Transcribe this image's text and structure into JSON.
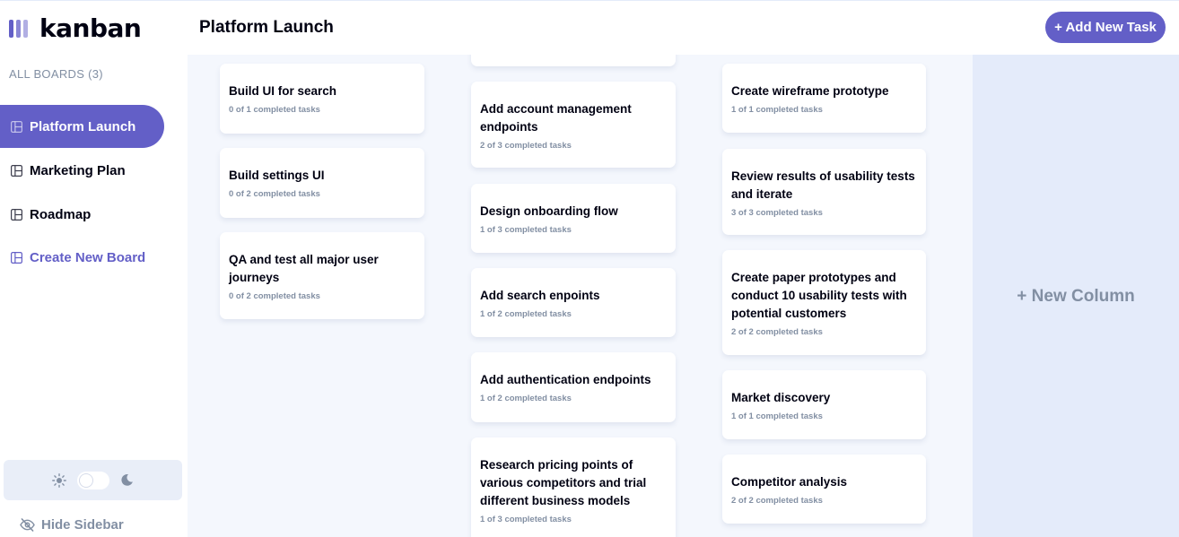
{
  "app": {
    "logo_text": "kanban",
    "accent": "#635fc7"
  },
  "sidebar": {
    "heading": "ALL BOARDS (3)",
    "boards": [
      {
        "label": "Platform Launch",
        "active": true
      },
      {
        "label": "Marketing Plan",
        "active": false
      },
      {
        "label": "Roadmap",
        "active": false
      }
    ],
    "create_label": "Create New Board",
    "hide_label": "Hide Sidebar",
    "theme": {
      "light_icon": "sun-icon",
      "dark_icon": "moon-icon",
      "dark_mode": false
    }
  },
  "header": {
    "title": "Platform Launch",
    "add_task_label": "+ Add New Task"
  },
  "columns": [
    {
      "cards": [
        {
          "title": "Build UI for search",
          "subtitle": "0 of 1 completed tasks"
        },
        {
          "title": "Build settings UI",
          "subtitle": "0 of 2 completed tasks"
        },
        {
          "title": "QA and test all major user journeys",
          "subtitle": "0 of 2 completed tasks"
        }
      ]
    },
    {
      "cards": [
        {
          "title": "",
          "subtitle": ""
        },
        {
          "title": "Add account management endpoints",
          "subtitle": "2 of 3 completed tasks"
        },
        {
          "title": "Design onboarding flow",
          "subtitle": "1 of 3 completed tasks"
        },
        {
          "title": "Add search enpoints",
          "subtitle": "1 of 2 completed tasks"
        },
        {
          "title": "Add authentication endpoints",
          "subtitle": "1 of 2 completed tasks"
        },
        {
          "title": "Research pricing points of various competitors and trial different business models",
          "subtitle": "1 of 3 completed tasks"
        }
      ]
    },
    {
      "cards": [
        {
          "title": "Create wireframe prototype",
          "subtitle": "1 of 1 completed tasks"
        },
        {
          "title": "Review results of usability tests and iterate",
          "subtitle": "3 of 3 completed tasks"
        },
        {
          "title": "Create paper prototypes and conduct 10 usability tests with potential customers",
          "subtitle": "2 of 2 completed tasks"
        },
        {
          "title": "Market discovery",
          "subtitle": "1 of 1 completed tasks"
        },
        {
          "title": "Competitor analysis",
          "subtitle": "2 of 2 completed tasks"
        }
      ]
    }
  ],
  "new_column_label": "+ New Column"
}
